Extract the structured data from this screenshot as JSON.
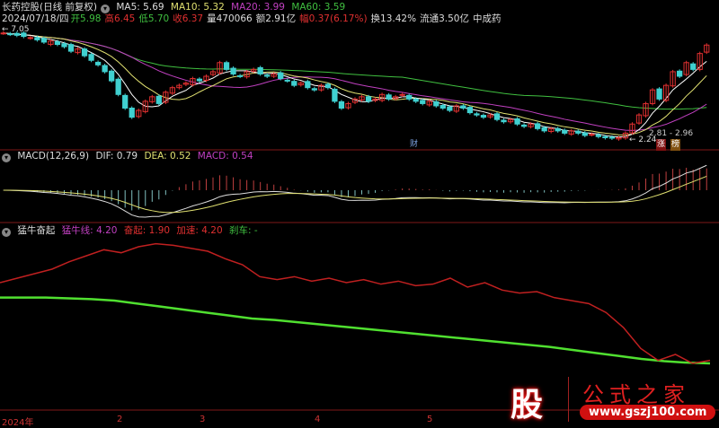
{
  "header": {
    "title": "长药控股(日线 前复权)",
    "ma5": "MA5: 5.69",
    "ma10": "MA10: 5.32",
    "ma20": "MA20: 3.99",
    "ma60": "MA60: 3.59"
  },
  "quote": {
    "date": "2024/07/18/四",
    "open": "开5.98",
    "high": "高6.45",
    "low": "低5.70",
    "close": "收6.37",
    "volume": "量470066",
    "amount": "额2.91亿",
    "change": "幅0.37(6.17%)",
    "turnover": "换13.42%",
    "float": "流通3.50亿",
    "sector": "中成药"
  },
  "price_annot": {
    "max": "← 7.05",
    "min": "← 2.24",
    "range": "2.81 - 2.96",
    "badge1": "财",
    "badge2": "涨",
    "badge3": "榜"
  },
  "macd": {
    "label": "MACD(12,26,9)",
    "dif": "DIF: 0.79",
    "dea": "DEA: 0.52",
    "macd": "MACD: 0.54"
  },
  "bull": {
    "label": "猛牛奋起",
    "line": "猛牛线: 4.20",
    "rise": "奋起: 1.90",
    "accel": "加速: 4.20",
    "brake": "刹车: -"
  },
  "axis": {
    "ticks": [
      "2024年",
      "2",
      "3",
      "4",
      "5"
    ]
  },
  "watermark": {
    "char": "股",
    "title": "公式之家",
    "url": "www.gszj100.com"
  },
  "colors": {
    "up": "#e03030",
    "down": "#40d0d0",
    "ma5": "#ffffff",
    "ma10": "#e0e070",
    "ma20": "#c040c0",
    "ma60": "#40c040"
  },
  "chart_data": {
    "type": "candlestick",
    "closes": [
      6.9,
      6.85,
      6.8,
      6.75,
      6.7,
      6.6,
      6.5,
      6.55,
      6.4,
      6.3,
      6.1,
      6.2,
      5.9,
      5.7,
      5.5,
      5.2,
      4.8,
      4.2,
      3.6,
      3.2,
      3.5,
      3.9,
      4.1,
      3.8,
      4.3,
      4.5,
      4.6,
      4.7,
      4.9,
      4.8,
      5.0,
      5.2,
      5.6,
      5.3,
      5.1,
      5.0,
      5.2,
      5.3,
      5.1,
      5.0,
      5.1,
      4.9,
      4.8,
      4.6,
      4.7,
      4.5,
      4.4,
      4.6,
      4.5,
      3.9,
      3.6,
      3.8,
      4.0,
      4.1,
      3.9,
      4.0,
      4.2,
      4.0,
      4.1,
      4.2,
      4.0,
      3.9,
      3.8,
      3.9,
      3.7,
      3.6,
      3.5,
      3.7,
      3.6,
      3.4,
      3.3,
      3.2,
      3.3,
      3.1,
      3.0,
      3.1,
      2.9,
      2.8,
      2.9,
      2.7,
      2.6,
      2.7,
      2.6,
      2.5,
      2.6,
      2.5,
      2.4,
      2.45,
      2.35,
      2.3,
      2.28,
      2.3,
      2.5,
      2.9,
      3.3,
      3.8,
      4.4,
      4.0,
      4.6,
      5.2,
      5.0,
      5.6,
      5.3,
      6.0,
      6.37
    ],
    "ylim": [
      2.24,
      7.05
    ],
    "bull_red": [
      6.0,
      6.3,
      6.6,
      6.9,
      7.4,
      7.8,
      8.2,
      8.0,
      8.4,
      8.6,
      8.5,
      8.3,
      8.1,
      7.6,
      7.2,
      6.4,
      6.2,
      6.4,
      6.1,
      6.3,
      6.0,
      6.2,
      5.9,
      6.1,
      5.8,
      5.9,
      6.3,
      5.7,
      6.0,
      5.5,
      5.3,
      5.4,
      5.0,
      4.8,
      4.6,
      4.0,
      3.0,
      1.6,
      0.8,
      1.2,
      0.6,
      0.8
    ],
    "bull_green": [
      5.0,
      5.0,
      5.0,
      4.95,
      4.9,
      4.8,
      4.6,
      4.4,
      4.2,
      4.0,
      3.8,
      3.6,
      3.5,
      3.35,
      3.2,
      3.05,
      2.9,
      2.75,
      2.6,
      2.45,
      2.3,
      2.15,
      2.0,
      1.85,
      1.7,
      1.5,
      1.3,
      1.1,
      0.9,
      0.75,
      0.65,
      0.6
    ],
    "bull_ylim": [
      0,
      9
    ]
  }
}
